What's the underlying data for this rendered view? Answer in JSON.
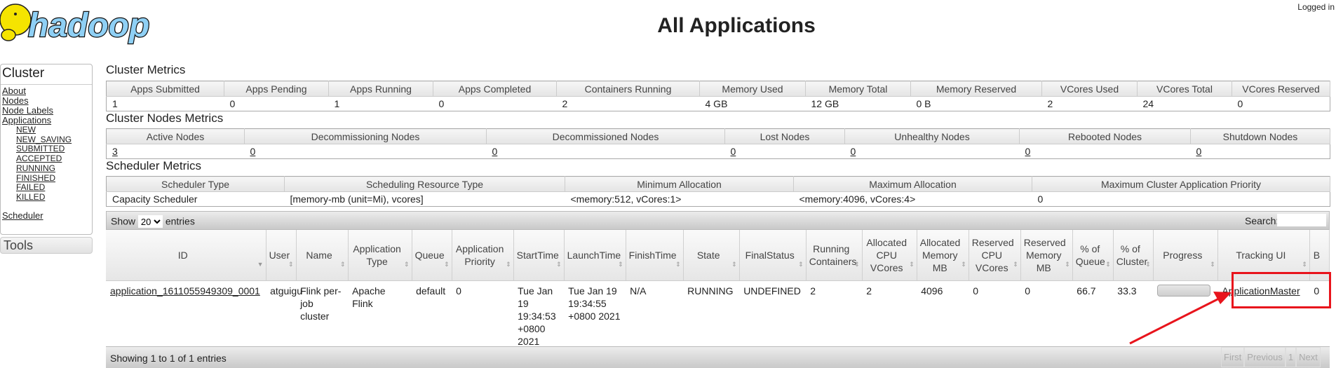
{
  "header": {
    "title": "All Applications",
    "logged_in": "Logged in",
    "logo_text": "hadoop"
  },
  "nav": {
    "cluster_label": "Cluster",
    "links": [
      "About",
      "Nodes",
      "Node Labels",
      "Applications"
    ],
    "app_states": [
      "NEW",
      "NEW_SAVING",
      "SUBMITTED",
      "ACCEPTED",
      "RUNNING",
      "FINISHED",
      "FAILED",
      "KILLED"
    ],
    "scheduler": "Scheduler",
    "tools_label": "Tools"
  },
  "cluster_metrics": {
    "title": "Cluster Metrics",
    "headers": [
      "Apps Submitted",
      "Apps Pending",
      "Apps Running",
      "Apps Completed",
      "Containers Running",
      "Memory Used",
      "Memory Total",
      "Memory Reserved",
      "VCores Used",
      "VCores Total",
      "VCores Reserved"
    ],
    "values": [
      "1",
      "0",
      "1",
      "0",
      "2",
      "4 GB",
      "12 GB",
      "0 B",
      "2",
      "24",
      "0"
    ]
  },
  "node_metrics": {
    "title": "Cluster Nodes Metrics",
    "headers": [
      "Active Nodes",
      "Decommissioning Nodes",
      "Decommissioned Nodes",
      "Lost Nodes",
      "Unhealthy Nodes",
      "Rebooted Nodes",
      "Shutdown Nodes"
    ],
    "values": [
      "3",
      "0",
      "0",
      "0",
      "0",
      "0",
      "0"
    ]
  },
  "scheduler_metrics": {
    "title": "Scheduler Metrics",
    "headers": [
      "Scheduler Type",
      "Scheduling Resource Type",
      "Minimum Allocation",
      "Maximum Allocation",
      "Maximum Cluster Application Priority"
    ],
    "values": [
      "Capacity Scheduler",
      "[memory-mb (unit=Mi), vcores]",
      "<memory:512, vCores:1>",
      "<memory:4096, vCores:4>",
      "0"
    ]
  },
  "toolbar": {
    "show": "Show",
    "page_size": "20",
    "entries": "entries",
    "search_label": "Search:",
    "search_value": ""
  },
  "apps": {
    "headers": [
      "ID",
      "User",
      "Name",
      "Application Type",
      "Queue",
      "Application Priority",
      "StartTime",
      "LaunchTime",
      "FinishTime",
      "State",
      "FinalStatus",
      "Running Containers",
      "Allocated CPU VCores",
      "Allocated Memory MB",
      "Reserved CPU VCores",
      "Reserved Memory MB",
      "% of Queue",
      "% of Cluster",
      "Progress",
      "Tracking UI",
      "B"
    ],
    "rows": [
      {
        "cells": [
          "application_1611055949309_0001",
          "atguigu",
          "Flink per-job cluster",
          "Apache Flink",
          "default",
          "0",
          "Tue Jan 19 19:34:53 +0800 2021",
          "Tue Jan 19 19:34:55 +0800 2021",
          "N/A",
          "RUNNING",
          "UNDEFINED",
          "2",
          "2",
          "4096",
          "0",
          "0",
          "66.7",
          "33.3",
          "",
          "ApplicationMaster",
          "0"
        ],
        "progress_percent": 100
      }
    ]
  },
  "footer": {
    "info": "Showing 1 to 1 of 1 entries",
    "pager": [
      "First",
      "Previous",
      "1",
      "Next"
    ]
  },
  "annotation": {
    "color": "#e8141c"
  }
}
